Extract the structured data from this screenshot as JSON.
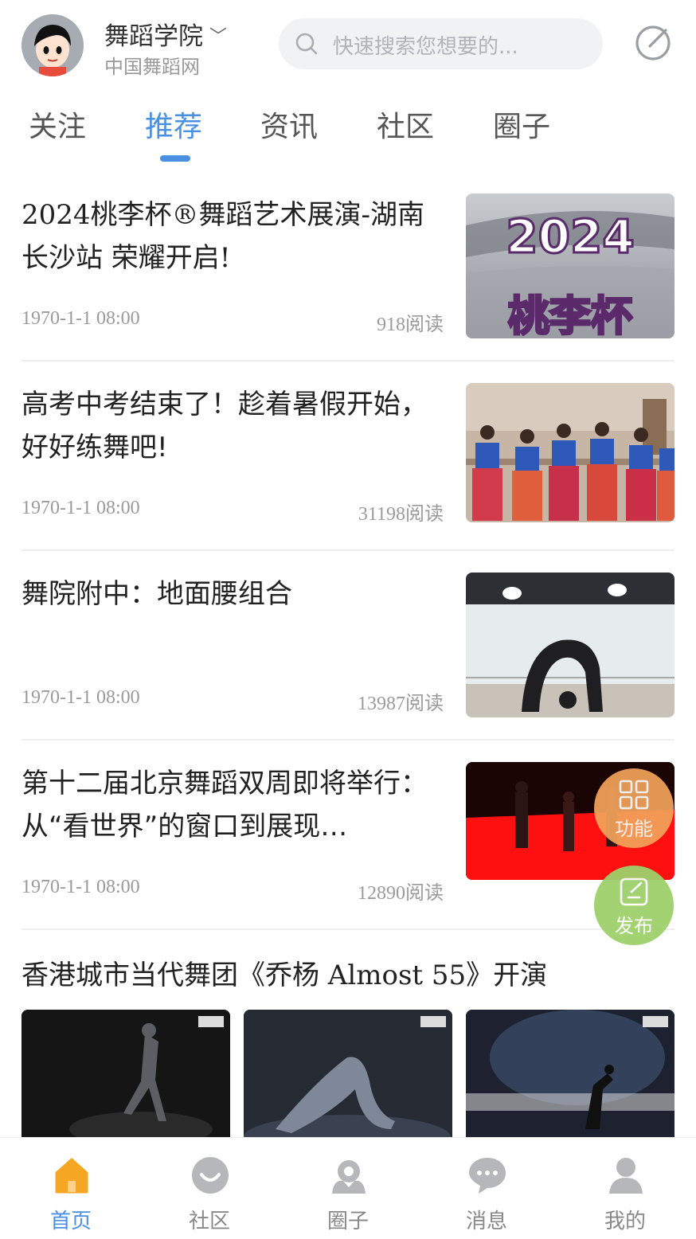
{
  "header": {
    "site_name": "舞蹈学院",
    "site_sub": "中国舞蹈网",
    "search_placeholder": "快速搜索您想要的..."
  },
  "tabs": [
    {
      "label": "关注",
      "active": false
    },
    {
      "label": "推荐",
      "active": true
    },
    {
      "label": "资讯",
      "active": false
    },
    {
      "label": "社区",
      "active": false
    },
    {
      "label": "圈子",
      "active": false
    }
  ],
  "articles": [
    {
      "title": "2024桃李杯®舞蹈艺术展演-湖南长沙站 荣耀开启!",
      "date": "1970-1-1 08:00",
      "reads": "918阅读",
      "thumb_text_1": "2024",
      "thumb_text_2": "桃李杯"
    },
    {
      "title": "高考中考结束了！趁着暑假开始，好好练舞吧!",
      "date": "1970-1-1 08:00",
      "reads": "31198阅读"
    },
    {
      "title": "舞院附中：地面腰组合",
      "date": "1970-1-1 08:00",
      "reads": "13987阅读"
    },
    {
      "title": "第十二届北京舞蹈双周即将举行：从“看世界”的窗口到展现…",
      "date": "1970-1-1 08:00",
      "reads": "12890阅读"
    }
  ],
  "gallery": {
    "title": "香港城市当代舞团《乔杨 Almost 55》开演"
  },
  "fab": {
    "function_label": "功能",
    "post_label": "发布"
  },
  "bottom_nav": [
    {
      "label": "首页",
      "icon": "home-icon",
      "active": true
    },
    {
      "label": "社区",
      "icon": "community-icon",
      "active": false
    },
    {
      "label": "圈子",
      "icon": "circle-icon",
      "active": false
    },
    {
      "label": "消息",
      "icon": "message-icon",
      "active": false
    },
    {
      "label": "我的",
      "icon": "profile-icon",
      "active": false
    }
  ],
  "colors": {
    "accent": "#4a90e2",
    "home_active": "#f5a623",
    "fab_function": "#f2a25a",
    "fab_post": "#9ed06a"
  }
}
